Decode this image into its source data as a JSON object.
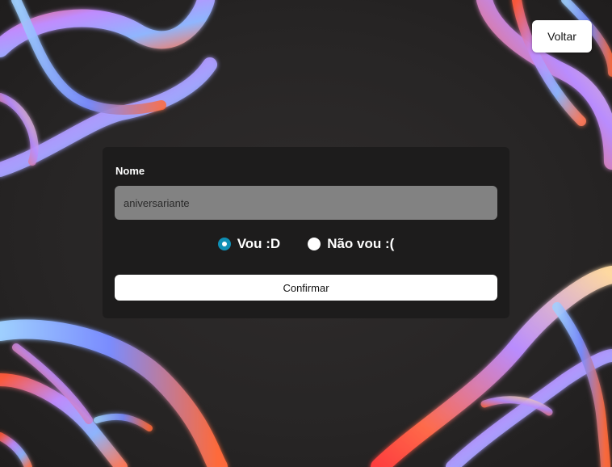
{
  "header": {
    "back_label": "Voltar"
  },
  "form": {
    "name_label": "Nome",
    "name_value": "aniversariante",
    "options": [
      {
        "label": "Vou :D",
        "checked": true
      },
      {
        "label": "Não vou :(",
        "checked": false
      }
    ],
    "confirm_label": "Confirmar"
  },
  "colors": {
    "accent": "#0f8fb5",
    "card_bg": "#1c1b1b",
    "input_bg": "#828282"
  }
}
